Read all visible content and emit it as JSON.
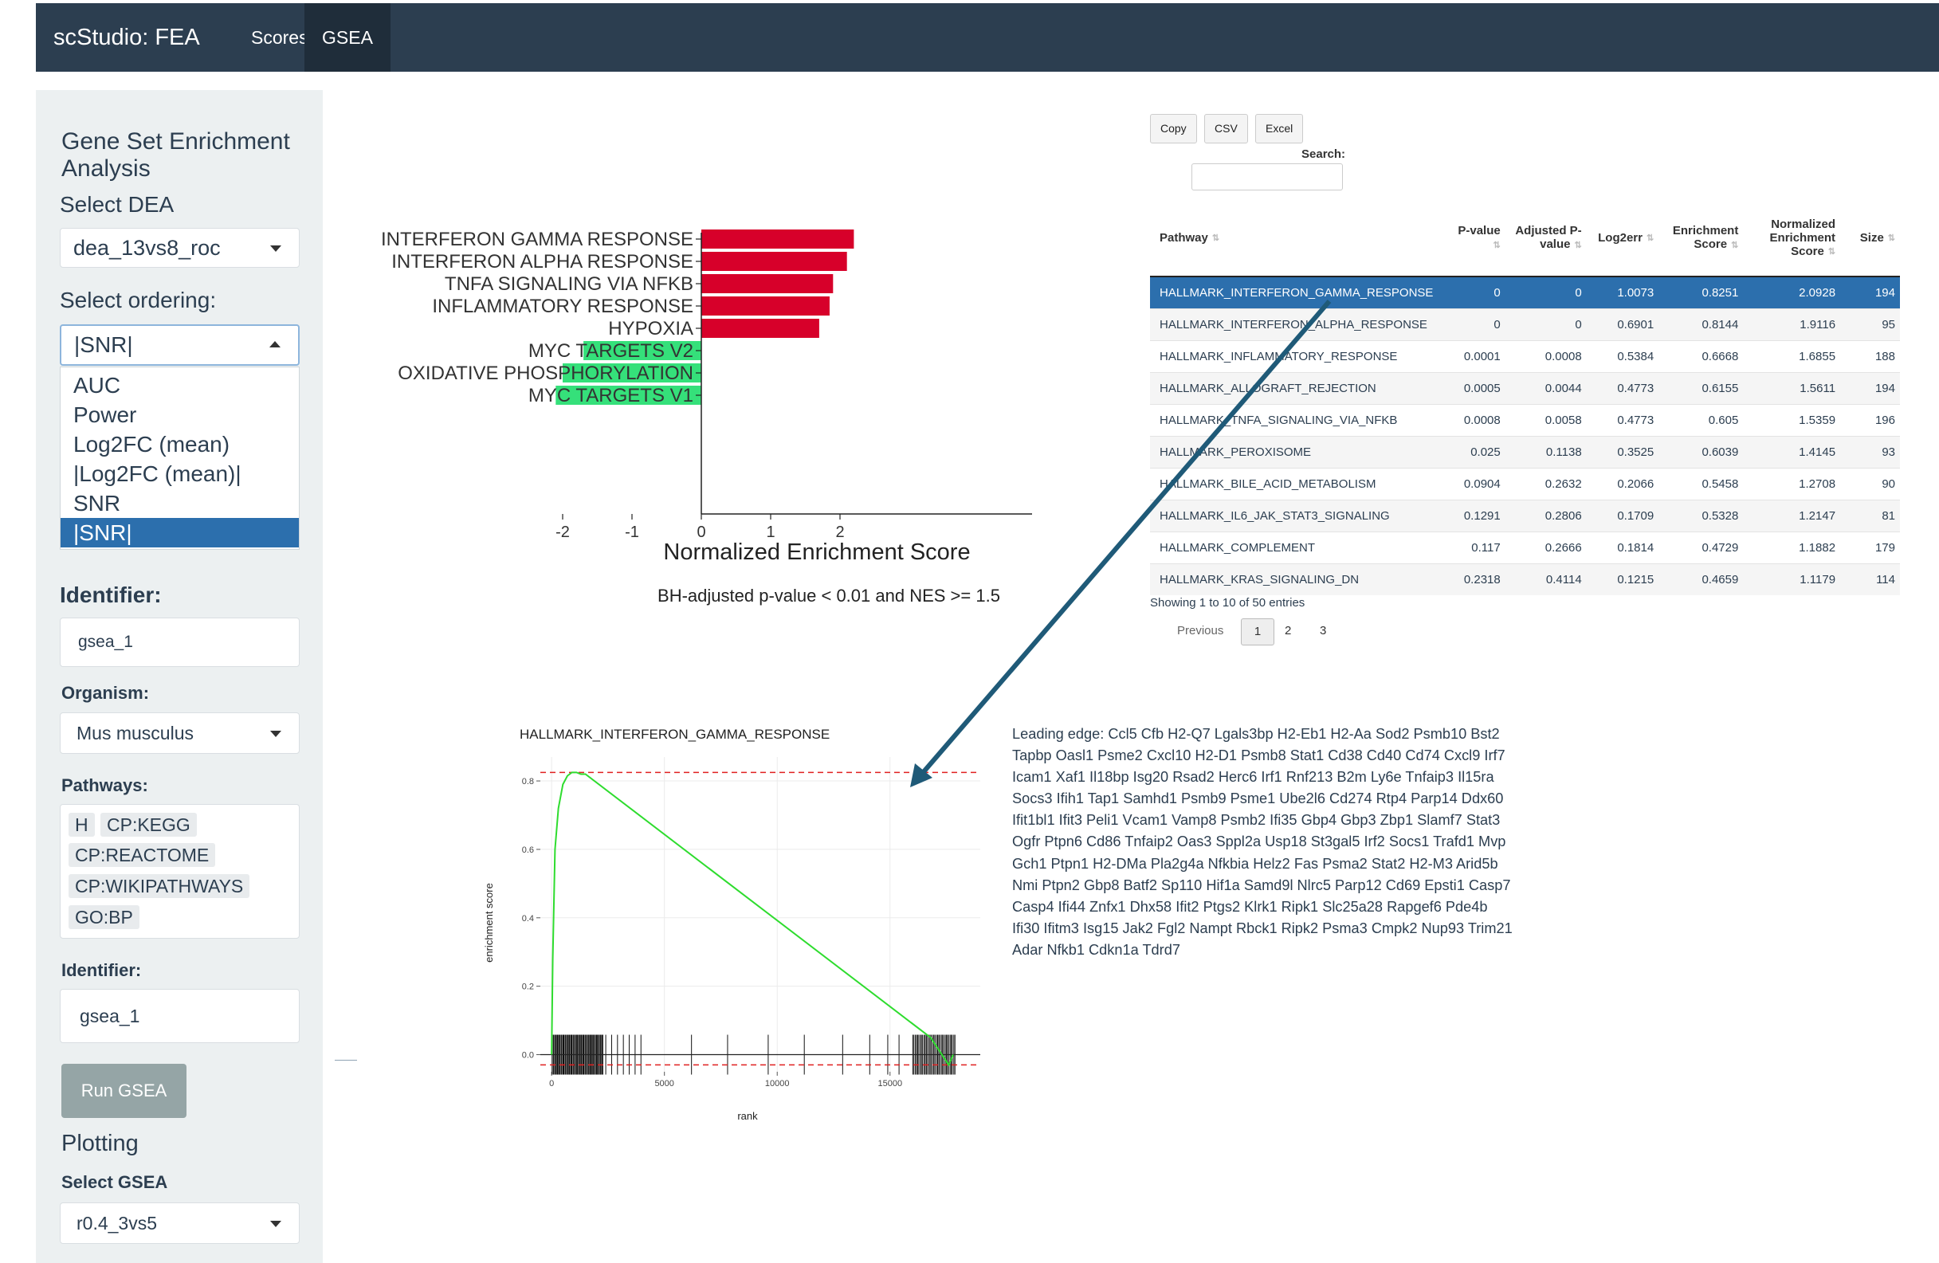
{
  "navbar": {
    "brand": "scStudio: FEA",
    "tabs": [
      "Scores",
      "GSEA"
    ],
    "active_tab": "GSEA"
  },
  "sidebar": {
    "title": "Gene Set Enrichment Analysis",
    "select_dea": {
      "label": "Select DEA",
      "value": "dea_13vs8_roc"
    },
    "select_ordering": {
      "label": "Select ordering:",
      "value": "|SNR|",
      "options": [
        "AUC",
        "Power",
        "Log2FC (mean)",
        "|Log2FC (mean)|",
        "SNR",
        "|SNR|"
      ],
      "selected_index": 5
    },
    "identifier1": {
      "label": "Identifier:",
      "value": "gsea_1"
    },
    "organism": {
      "label": "Organism:",
      "value": "Mus musculus"
    },
    "pathways": {
      "label": "Pathways:",
      "chips": [
        "H",
        "CP:KEGG",
        "CP:REACTOME",
        "CP:WIKIPATHWAYS",
        "GO:BP"
      ]
    },
    "identifier2": {
      "label": "Identifier:",
      "value": "gsea_1"
    },
    "run_button": "Run GSEA",
    "plotting_title": "Plotting",
    "select_gsea": {
      "label": "Select GSEA",
      "value": "r0.4_3vs5"
    }
  },
  "table": {
    "buttons": [
      "Copy",
      "CSV",
      "Excel"
    ],
    "search_label": "Search:",
    "search_value": "",
    "columns": [
      "Pathway",
      "P-value",
      "Adjusted P-value",
      "Log2err",
      "Enrichment Score",
      "Normalized Enrichment Score",
      "Size"
    ],
    "rows": [
      [
        "HALLMARK_INTERFERON_GAMMA_RESPONSE",
        "0",
        "0",
        "1.0073",
        "0.8251",
        "2.0928",
        "194"
      ],
      [
        "HALLMARK_INTERFERON_ALPHA_RESPONSE",
        "0",
        "0",
        "0.6901",
        "0.8144",
        "1.9116",
        "95"
      ],
      [
        "HALLMARK_INFLAMMATORY_RESPONSE",
        "0.0001",
        "0.0008",
        "0.5384",
        "0.6668",
        "1.6855",
        "188"
      ],
      [
        "HALLMARK_ALLOGRAFT_REJECTION",
        "0.0005",
        "0.0044",
        "0.4773",
        "0.6155",
        "1.5611",
        "194"
      ],
      [
        "HALLMARK_TNFA_SIGNALING_VIA_NFKB",
        "0.0008",
        "0.0058",
        "0.4773",
        "0.605",
        "1.5359",
        "196"
      ],
      [
        "HALLMARK_PEROXISOME",
        "0.025",
        "0.1138",
        "0.3525",
        "0.6039",
        "1.4145",
        "93"
      ],
      [
        "HALLMARK_BILE_ACID_METABOLISM",
        "0.0904",
        "0.2632",
        "0.2066",
        "0.5458",
        "1.2708",
        "90"
      ],
      [
        "HALLMARK_IL6_JAK_STAT3_SIGNALING",
        "0.1291",
        "0.2806",
        "0.1709",
        "0.5328",
        "1.2147",
        "81"
      ],
      [
        "HALLMARK_COMPLEMENT",
        "0.117",
        "0.2666",
        "0.1814",
        "0.4729",
        "1.1882",
        "179"
      ],
      [
        "HALLMARK_KRAS_SIGNALING_DN",
        "0.2318",
        "0.4114",
        "0.1215",
        "0.4659",
        "1.1179",
        "114"
      ]
    ],
    "selected_row": 0,
    "info": "Showing 1 to 10 of 50 entries",
    "pagination": {
      "previous": "Previous",
      "pages": [
        "1",
        "2",
        "3"
      ],
      "current": "1"
    }
  },
  "leading_edge": "Leading edge: Ccl5 Cfb H2-Q7 Lgals3bp H2-Eb1 H2-Aa Sod2 Psmb10 Bst2 Tapbp Oasl1 Psme2 Cxcl10 H2-D1 Psmb8 Stat1 Cd38 Cd40 Cd74 Cxcl9 Irf7 Icam1 Xaf1 Il18bp Isg20 Rsad2 Herc6 Irf1 Rnf213 B2m Ly6e Tnfaip3 Il15ra Socs3 Ifih1 Tap1 Samhd1 Psmb9 Psme1 Ube2l6 Cd274 Rtp4 Parp14 Ddx60 Ifit1bl1 Ifit3 Peli1 Vcam1 Vamp8 Psmb2 Ifi35 Gbp4 Gbp3 Zbp1 Slamf7 Stat3 Ogfr Ptpn6 Cd86 Tnfaip2 Oas3 Sppl2a Usp18 St3gal5 Irf2 Socs1 Trafd1 Mvp Gch1 Ptpn1 H2-DMa Pla2g4a Nfkbia Helz2 Fas Psma2 Stat2 H2-M3 Arid5b Nmi Ptpn2 Gbp8 Batf2 Sp110 Hif1a Samd9l Nlrc5 Parp12 Cd69 Epsti1 Casp7 Casp4 Ifi44 Znfx1 Dhx58 Ifit2 Ptgs2 Klrk1 Ripk1 Slc25a28 Rapgef6 Pde4b Ifi30 Ifitm3 Isg15 Jak2 Fgl2 Nampt Rbck1 Ripk2 Psma3 Cmpk2 Nup93 Trim21 Adar Nfkb1 Cdkn1a Tdrd7",
  "colors": {
    "positive_bar": "#d7002a",
    "negative_bar": "#35e07a",
    "nav_bg": "#2c3e50",
    "selected": "#2c6fad",
    "es_curve": "#2edc2e",
    "arrow": "#1f5a78"
  },
  "chart_data": [
    {
      "type": "bar",
      "orientation": "horizontal",
      "categories": [
        "INTERFERON GAMMA RESPONSE",
        "INTERFERON ALPHA RESPONSE",
        "TNFA SIGNALING VIA NFKB",
        "INFLAMMATORY RESPONSE",
        "HYPOXIA",
        "MYC TARGETS V2",
        "OXIDATIVE PHOSPHORYLATION",
        "MYC TARGETS V1"
      ],
      "values": [
        2.2,
        2.1,
        1.9,
        1.85,
        1.7,
        -1.7,
        -2.0,
        -2.1
      ],
      "xlabel": "Normalized Enrichment Score",
      "caption": "BH-adjusted p-value < 0.01 and NES >= 1.5",
      "xlim": [
        -2.3,
        2.3
      ],
      "xticks": [
        "-2",
        "-1",
        "0",
        "1",
        "2"
      ],
      "grid": false
    },
    {
      "type": "line",
      "title": "HALLMARK_INTERFERON_GAMMA_RESPONSE",
      "xlabel": "rank",
      "ylabel": "enrichment score",
      "xlim": [
        -500,
        19000
      ],
      "ylim": [
        -0.05,
        0.87
      ],
      "xticks": [
        "0",
        "5000",
        "10000",
        "15000"
      ],
      "yticks": [
        "0.0",
        "0.2",
        "0.4",
        "0.6",
        "0.8"
      ],
      "max_es": 0.825,
      "min_es": -0.03,
      "x": [
        0,
        50,
        150,
        300,
        500,
        700,
        900,
        1100,
        1300,
        1500,
        16800,
        17300,
        17600,
        17800
      ],
      "y": [
        0.0,
        0.28,
        0.6,
        0.72,
        0.79,
        0.815,
        0.825,
        0.825,
        0.82,
        0.82,
        0.05,
        0.0,
        -0.03,
        0.0
      ],
      "grid": true
    }
  ]
}
